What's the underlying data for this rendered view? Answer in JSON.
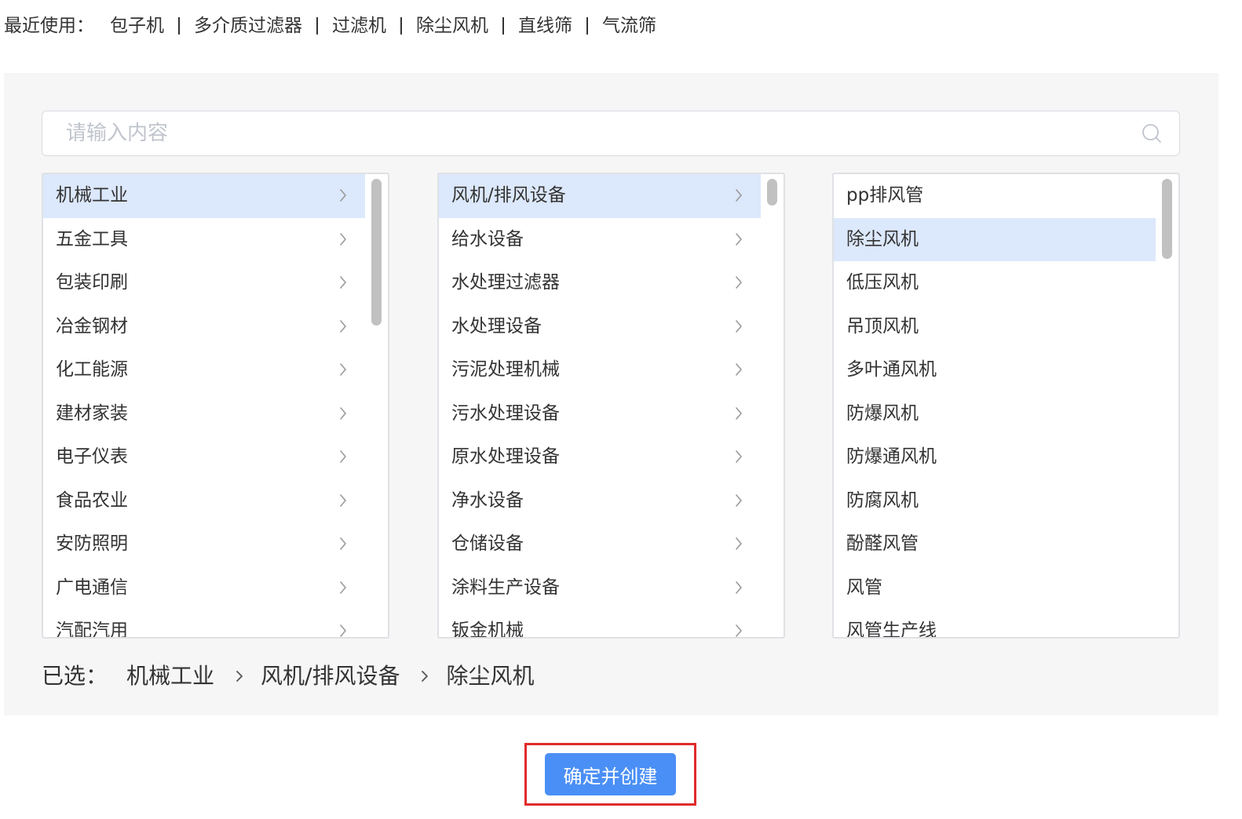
{
  "recent": {
    "label": "最近使用：",
    "items": [
      "包子机",
      "多介质过滤器",
      "过滤机",
      "除尘风机",
      "直线筛",
      "气流筛"
    ]
  },
  "search": {
    "placeholder": "请输入内容",
    "value": "",
    "icon": "search-icon"
  },
  "columns": [
    {
      "items": [
        "机械工业",
        "五金工具",
        "包装印刷",
        "冶金钢材",
        "化工能源",
        "建材家装",
        "电子仪表",
        "食品农业",
        "安防照明",
        "广电通信",
        "汽配汽用"
      ],
      "selected_index": 0,
      "has_children": true,
      "item_icon": "chevron-right-icon"
    },
    {
      "items": [
        "风机/排风设备",
        "给水设备",
        "水处理过滤器",
        "水处理设备",
        "污泥处理机械",
        "污水处理设备",
        "原水处理设备",
        "净水设备",
        "仓储设备",
        "涂料生产设备",
        "钣金机械"
      ],
      "selected_index": 0,
      "has_children": true,
      "item_icon": "chevron-right-icon"
    },
    {
      "items": [
        "pp排风管",
        "除尘风机",
        "低压风机",
        "吊顶风机",
        "多叶通风机",
        "防爆风机",
        "防爆通风机",
        "防腐风机",
        "酚醛风管",
        "风管",
        "风管生产线"
      ],
      "selected_index": 1,
      "has_children": false
    }
  ],
  "selected_path": {
    "label": "已选：",
    "items": [
      "机械工业",
      "风机/排风设备",
      "除尘风机"
    ],
    "separator_icon": "chevron-right-icon"
  },
  "confirm_button": {
    "label": "确定并创建"
  },
  "colors": {
    "primary": "#4a8ff5",
    "selected_row_bg": "#dce8fb",
    "panel_bg": "#f6f6f6",
    "text": "#333333",
    "highlight_border": "#e02b2b"
  }
}
